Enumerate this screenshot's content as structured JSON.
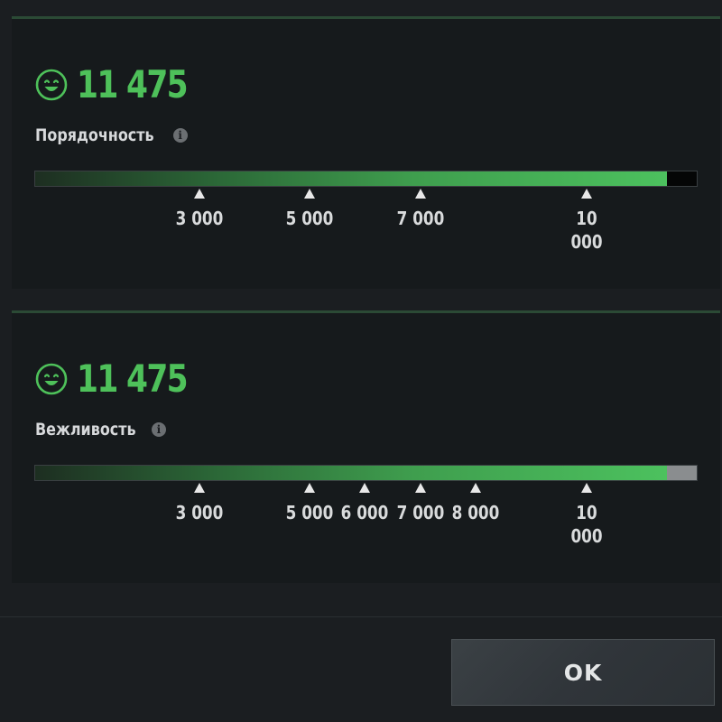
{
  "colors": {
    "accent_green": "#4ec15a",
    "background": "#161a1c",
    "tick_marker": "#e8e8e8"
  },
  "metrics": [
    {
      "score": "11 475",
      "label": "Порядочность",
      "icon": "smiley-face-icon",
      "info_icon": "info-icon",
      "bar_fill_fraction": 0.955,
      "remainder_color": "#050606",
      "ticks": [
        {
          "label": "3 000",
          "position_fraction": 0.249
        },
        {
          "label": "5 000",
          "position_fraction": 0.415
        },
        {
          "label": "7 000",
          "position_fraction": 0.582
        },
        {
          "label": "10\n000",
          "position_fraction": 0.832
        }
      ]
    },
    {
      "score": "11 475",
      "label": "Вежливость",
      "icon": "smiley-face-icon",
      "info_icon": "info-icon",
      "bar_fill_fraction": 0.955,
      "remainder_color": "#8a8d8f",
      "ticks": [
        {
          "label": "3 000",
          "position_fraction": 0.249
        },
        {
          "label": "5 000",
          "position_fraction": 0.415
        },
        {
          "label": "6 000",
          "position_fraction": 0.498
        },
        {
          "label": "7 000",
          "position_fraction": 0.582
        },
        {
          "label": "8 000",
          "position_fraction": 0.665
        },
        {
          "label": "10\n000",
          "position_fraction": 0.832
        }
      ]
    }
  ],
  "footer": {
    "ok_label": "OK"
  }
}
